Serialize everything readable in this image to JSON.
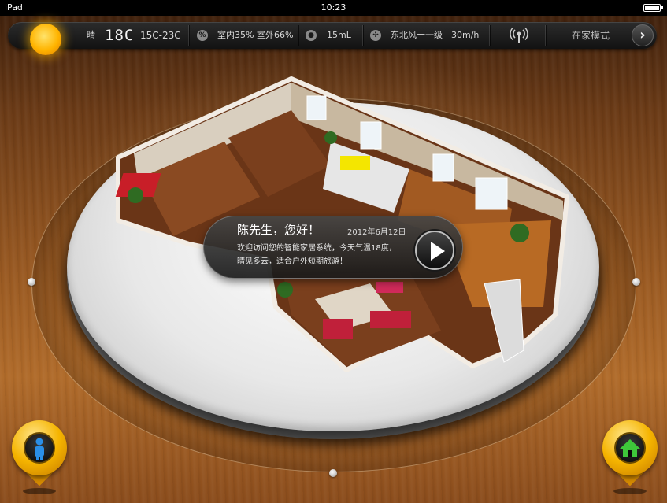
{
  "status_bar": {
    "device": "iPad",
    "time": "10:23"
  },
  "top_bar": {
    "weather_condition": "晴",
    "current_temp": "18C",
    "temp_range": "15C-23C",
    "humidity_indoor": "室内35%",
    "humidity_outdoor": "室外66%",
    "rainfall": "15mL",
    "wind_direction": "东北风十一级",
    "wind_speed": "30m/h",
    "mode": "在家模式",
    "next_symbol": "›"
  },
  "welcome": {
    "greeting": "陈先生，您好！",
    "date": "2012年6月12日",
    "message_line1": "欢迎访问您的智能家居系统，今天气温18度，",
    "message_line2": "晴见多云，适合户外短期旅游！"
  },
  "colors": {
    "accent_gold": "#f5b400",
    "person_blue": "#2a8fe8",
    "home_green": "#3ec83a"
  },
  "icons": {
    "weather": "sun-icon",
    "humidity": "humidity-icon",
    "rain": "raindrop-icon",
    "wind": "fan-icon",
    "signal": "antenna-icon",
    "next": "chevron-right-icon",
    "user": "person-icon",
    "home": "home-icon",
    "play": "play-icon"
  }
}
